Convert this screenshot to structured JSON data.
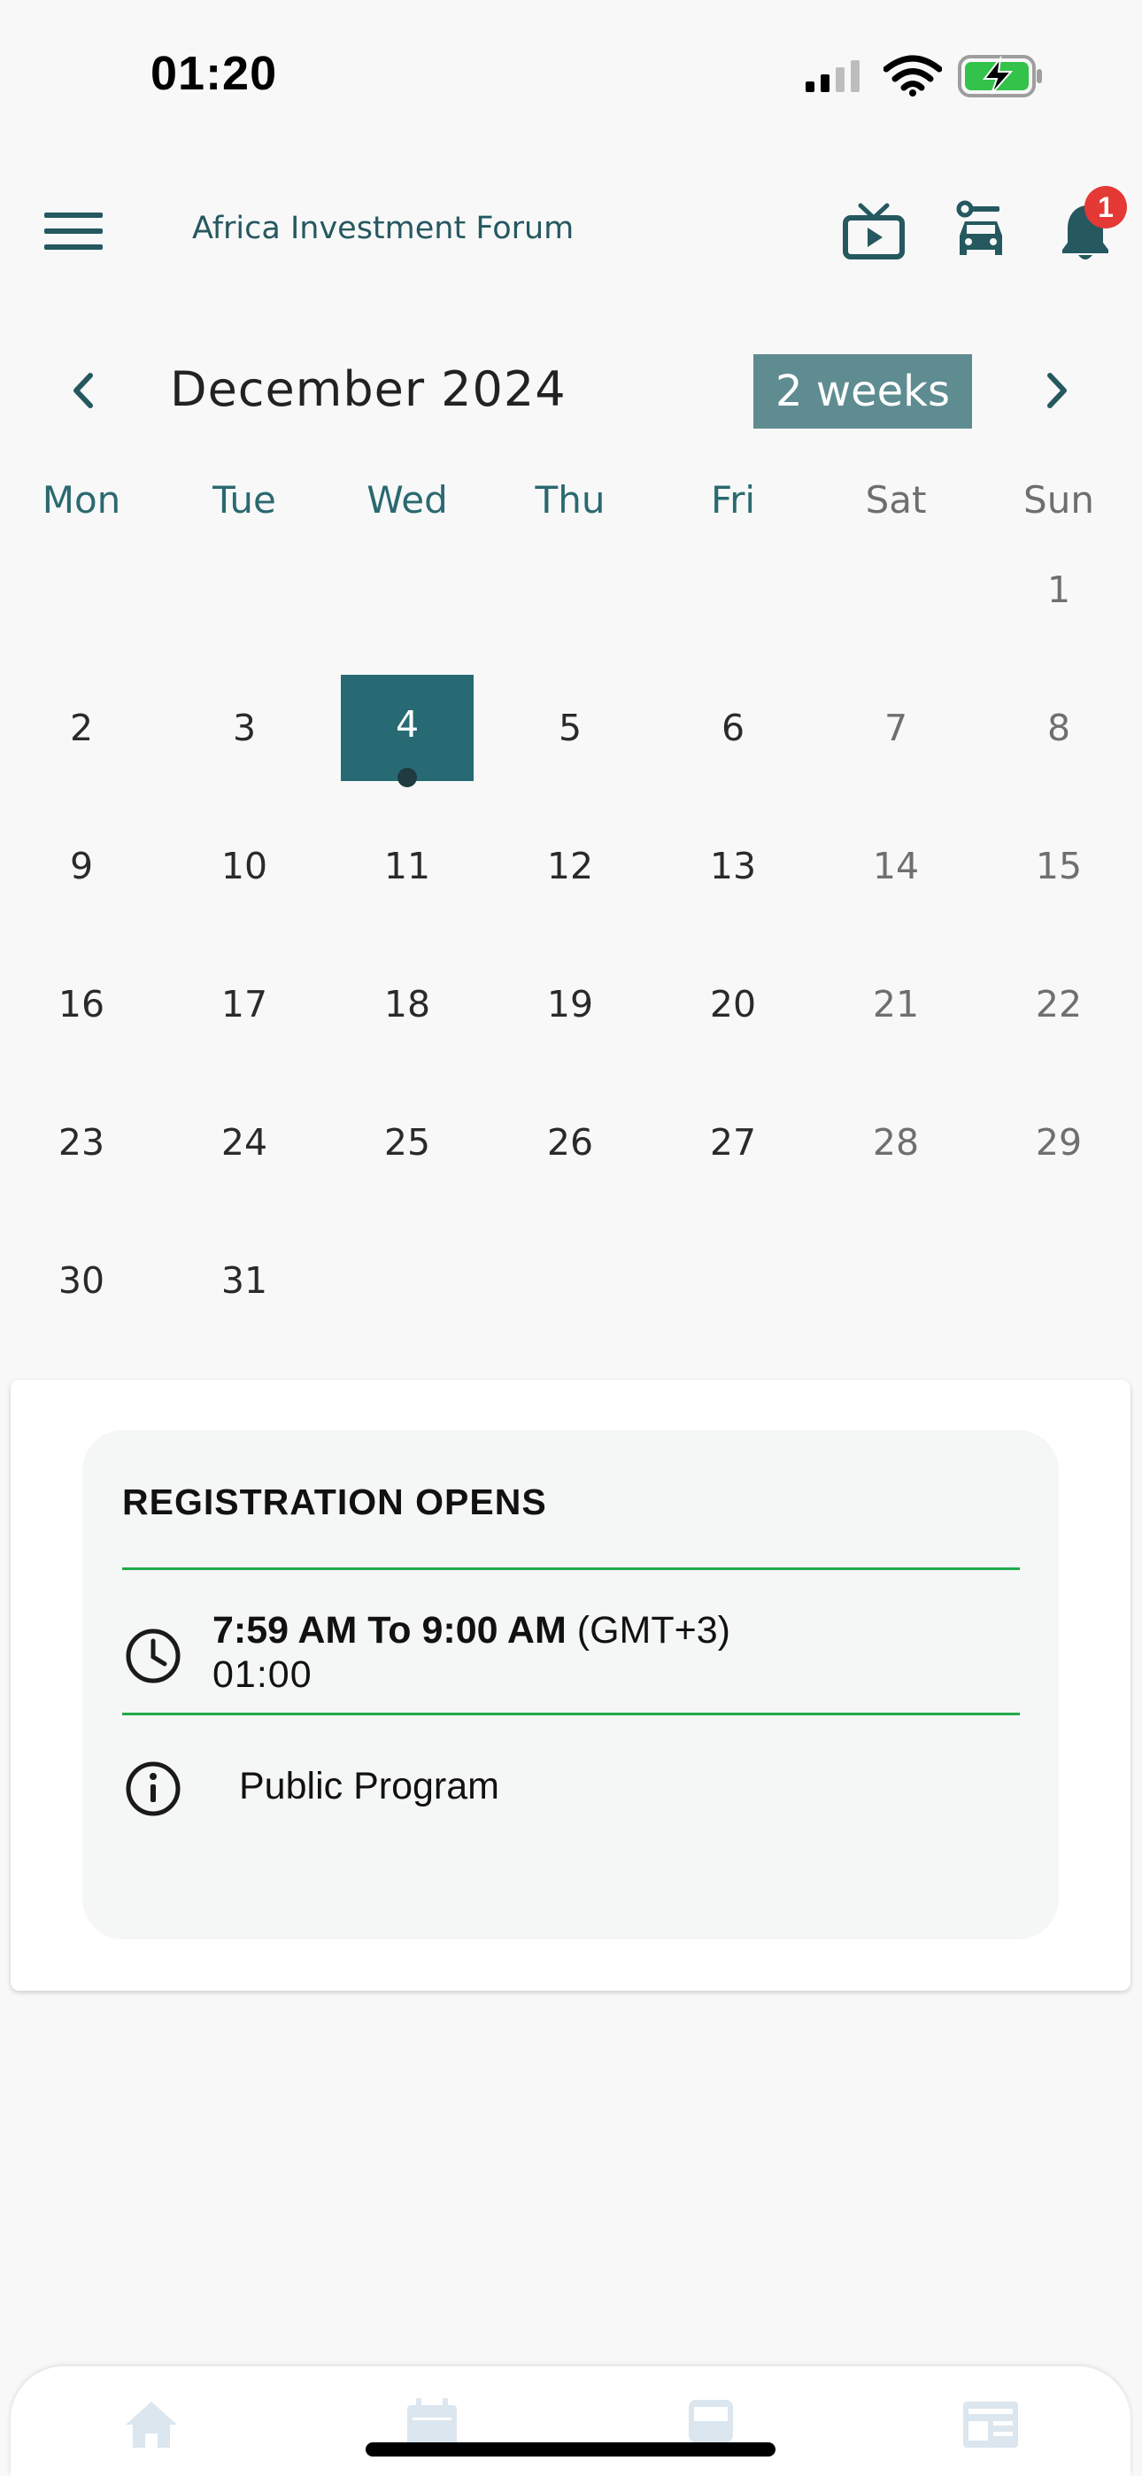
{
  "status_bar": {
    "time": "01:20"
  },
  "header": {
    "title": "Africa Investment Forum",
    "notification_count": "1"
  },
  "calendar": {
    "month_label": "December 2024",
    "range_toggle": "2 weeks",
    "weekdays": [
      "Mon",
      "Tue",
      "Wed",
      "Thu",
      "Fri",
      "Sat",
      "Sun"
    ],
    "weeks": [
      [
        "",
        "",
        "",
        "",
        "",
        "",
        "1"
      ],
      [
        "2",
        "3",
        "4",
        "5",
        "6",
        "7",
        "8"
      ],
      [
        "9",
        "10",
        "11",
        "12",
        "13",
        "14",
        "15"
      ],
      [
        "16",
        "17",
        "18",
        "19",
        "20",
        "21",
        "22"
      ],
      [
        "23",
        "24",
        "25",
        "26",
        "27",
        "28",
        "29"
      ],
      [
        "30",
        "31",
        "",
        "",
        "",
        "",
        ""
      ]
    ],
    "selected_day": "4",
    "days_with_events": [
      "4"
    ]
  },
  "event": {
    "title": "REGISTRATION OPENS",
    "time_range": "7:59 AM To 9:00 AM",
    "timezone": "(GMT+3)",
    "duration": "01:00",
    "category": "Public Program"
  },
  "colors": {
    "accent": "#276a73",
    "toggle_bg": "#5e8c91",
    "divider": "#1faa4a",
    "badge": "#e53935"
  },
  "icons": {
    "menu": "hamburger-menu-icon",
    "tv": "tv-play-icon",
    "car": "car-icon",
    "bell": "bell-icon",
    "prev": "chevron-left-icon",
    "next": "chevron-right-icon",
    "clock": "clock-icon",
    "info": "info-icon",
    "nav": [
      "home-icon",
      "calendar-icon",
      "bus-icon",
      "news-icon"
    ]
  }
}
